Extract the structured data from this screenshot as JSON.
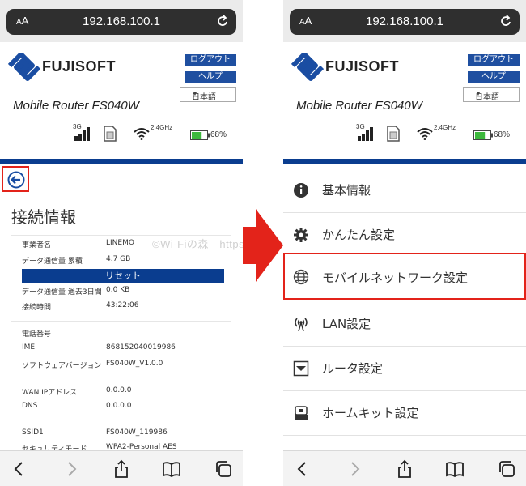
{
  "browser": {
    "aa_small": "A",
    "aa_large": "A",
    "url": "192.168.100.1"
  },
  "header": {
    "brand": "FUJISOFT",
    "logout_label": "ログアウト",
    "help_label": "ヘルプ",
    "language": "日本語",
    "model": "Mobile Router FS040W"
  },
  "status": {
    "network_type": "3G",
    "wifi_band": "2.4GHz",
    "battery_percent": "68%",
    "battery_level": 0.68
  },
  "left": {
    "section_title": "接続情報",
    "reset_label": "リセット",
    "rows_group1": [
      {
        "label": "事業者名",
        "value": "LINEMO"
      },
      {
        "label": "データ通信量 累積",
        "value": "4.7 GB"
      }
    ],
    "rows_group1b": [
      {
        "label": "データ通信量 過去3日間",
        "value": "0.0 KB"
      },
      {
        "label": "接続時間",
        "value": "43:22:06"
      }
    ],
    "rows_group2": [
      {
        "label": "電話番号",
        "value": ""
      },
      {
        "label": "IMEI",
        "value": "868152040019986"
      },
      {
        "label": "ソフトウェアバージョン",
        "value": "FS040W_V1.0.0"
      }
    ],
    "rows_group3": [
      {
        "label": "WAN IPアドレス",
        "value": "0.0.0.0"
      },
      {
        "label": "DNS",
        "value": "0.0.0.0"
      }
    ],
    "rows_group4": [
      {
        "label": "SSID1",
        "value": "FS040W_119986"
      },
      {
        "label": "セキュリティモード",
        "value": "WPA2-Personal AES"
      }
    ]
  },
  "watermark": "©Wi-Fiの森　https://wifinomori.com",
  "menu": {
    "items": [
      {
        "label": "基本情報",
        "icon": "info-icon"
      },
      {
        "label": "かんたん設定",
        "icon": "gear-icon"
      },
      {
        "label": "モバイルネットワーク設定",
        "icon": "globe-icon"
      },
      {
        "label": "LAN設定",
        "icon": "antenna-icon"
      },
      {
        "label": "ルータ設定",
        "icon": "router-icon"
      },
      {
        "label": "ホームキット設定",
        "icon": "homekit-icon"
      }
    ],
    "highlighted_index": 2
  },
  "colors": {
    "brand_blue": "#0a3d8f",
    "button_blue": "#1f4fa0",
    "highlight_red": "#e3231a",
    "battery_green": "#3db83d"
  }
}
